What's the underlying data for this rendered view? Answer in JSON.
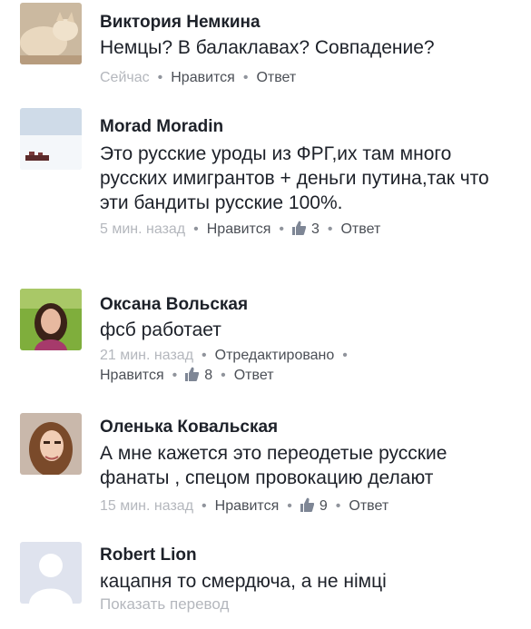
{
  "comments": [
    {
      "name": "Виктория Немкина",
      "text": "Немцы?  В балаклавах?  Совпадение?",
      "time": "Сейчас",
      "like_label": "Нравится",
      "reply_label": "Ответ"
    },
    {
      "name": "Morad Moradin",
      "text": "Это русские уроды из ФРГ,их там много русских имигрантов + деньги путина,так что эти бандиты русские 100%.",
      "time": "5 мин. назад",
      "like_label": "Нравится",
      "likes": "3",
      "reply_label": "Ответ"
    },
    {
      "name": "Оксана Вольская",
      "text": "фсб работает",
      "time": "21 мин. назад",
      "edited_label": "Отредактировано",
      "like_label": "Нравится",
      "likes": "8",
      "reply_label": "Ответ"
    },
    {
      "name": "Оленька Ковальская",
      "text": "А мне кажется это переодетые русские фанаты , спецом провокацию делают",
      "time": "15 мин. назад",
      "like_label": "Нравится",
      "likes": "9",
      "reply_label": "Ответ"
    },
    {
      "name": "Robert Lion",
      "text": "кацапня то смердюча, а не німці",
      "translate_label": "Показать перевод"
    }
  ],
  "icons": {
    "like": "thumbs-up-icon"
  },
  "colors": {
    "meta_gray": "#90949c",
    "action_gray": "#4b4f56",
    "name": "#1d2129"
  }
}
